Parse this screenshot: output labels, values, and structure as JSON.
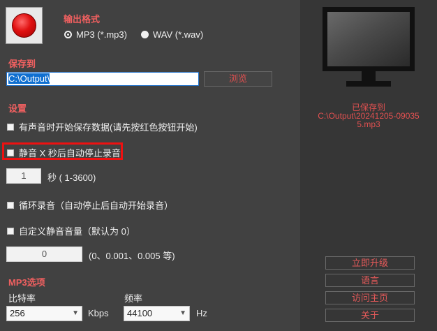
{
  "output_format": {
    "title": "输出格式",
    "options": [
      {
        "label": "MP3 (*.mp3)",
        "selected": true
      },
      {
        "label": "WAV (*.wav)",
        "selected": false
      }
    ]
  },
  "save_to": {
    "title": "保存到",
    "path": "C:\\Output\\",
    "browse_label": "浏览"
  },
  "settings": {
    "title": "设置",
    "start_on_sound_label": "有声音时开始保存数据(请先按红色按钮开始)",
    "auto_stop_label": "静音 X 秒后自动停止录音",
    "seconds_value": "1",
    "seconds_label": "秒 ( 1-3600)",
    "loop_label": "循环录音（自动停止后自动开始录音）",
    "custom_silence_label": "自定义静音音量（默认为 0）",
    "silence_value": "0",
    "silence_hint": "(0、0.001、0.005 等)"
  },
  "mp3_options": {
    "title": "MP3选项",
    "bitrate_label": "比特率",
    "bitrate_value": "256",
    "bitrate_unit": "Kbps",
    "freq_label": "频率",
    "freq_value": "44100",
    "freq_unit": "Hz"
  },
  "status": {
    "saved_title": "已保存到",
    "saved_path_line1": "C:\\Output\\20241205-09035",
    "saved_path_line2": "5.mp3"
  },
  "side_buttons": {
    "upgrade": "立即升级",
    "language": "语言",
    "homepage": "访问主页",
    "about": "关于"
  },
  "colors": {
    "accent_red": "#f06060",
    "highlight_border": "#ee1111",
    "background": "#414141"
  }
}
